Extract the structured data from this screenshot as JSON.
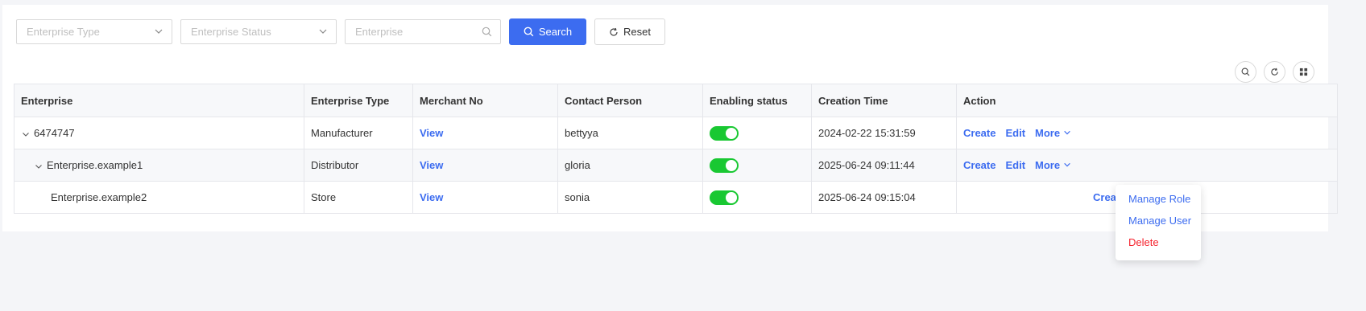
{
  "filters": {
    "enterprise_type_placeholder": "Enterprise Type",
    "enterprise_status_placeholder": "Enterprise Status",
    "enterprise_placeholder": "Enterprise",
    "search_label": "Search",
    "reset_label": "Reset"
  },
  "table": {
    "columns": {
      "enterprise": "Enterprise",
      "type": "Enterprise Type",
      "merchant": "Merchant No",
      "contact": "Contact Person",
      "status": "Enabling status",
      "created": "Creation Time",
      "action": "Action"
    },
    "rows": [
      {
        "enterprise": "6474747",
        "type": "Manufacturer",
        "merchant": "View",
        "contact": "bettyya",
        "enabled": true,
        "created": "2024-02-22 15:31:59",
        "create": "Create",
        "edit": "Edit",
        "more": "More",
        "level": 0,
        "expandable": true
      },
      {
        "enterprise": "Enterprise.example1",
        "type": "Distributor",
        "merchant": "View",
        "contact": "gloria",
        "enabled": true,
        "created": "2025-06-24 09:11:44",
        "create": "Create",
        "edit": "Edit",
        "more": "More",
        "level": 1,
        "expandable": true
      },
      {
        "enterprise": "Enterprise.example2",
        "type": "Store",
        "merchant": "View",
        "contact": "sonia",
        "enabled": true,
        "created": "2025-06-24 09:15:04",
        "create": "Crea",
        "level": 2,
        "expandable": false
      }
    ]
  },
  "dropdown": {
    "manage_role": "Manage Role",
    "manage_user": "Manage User",
    "delete": "Delete"
  },
  "colors": {
    "primary": "#3c6cf0",
    "toggle_on": "#19c832",
    "danger": "#f5222d"
  }
}
